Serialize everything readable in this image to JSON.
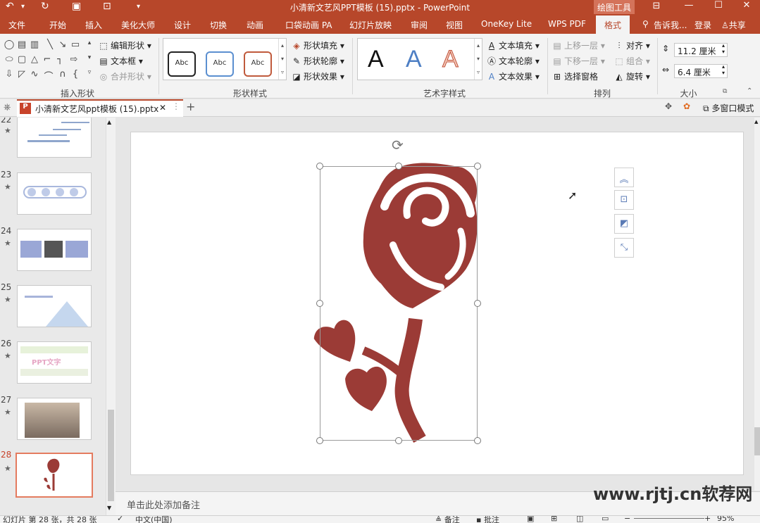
{
  "window": {
    "title": "小清新文艺风PPT模板 (15).pptx - PowerPoint",
    "context_tab": "绘图工具",
    "quick_access": [
      "undo-icon",
      "redo-icon",
      "save-icon",
      "present-icon",
      "customize-icon"
    ]
  },
  "ribbon_tabs": [
    "文件",
    "开始",
    "插入",
    "美化大师",
    "设计",
    "切换",
    "动画",
    "口袋动画 PA",
    "幻灯片放映",
    "审阅",
    "视图",
    "OneKey Lite",
    "WPS PDF",
    "格式"
  ],
  "active_tab": "格式",
  "tell_me": "告诉我...",
  "login": "登录",
  "share": "共享",
  "groups": {
    "insert_shapes": {
      "label": "插入形状",
      "edit_shape": "编辑形状",
      "textbox": "文本框",
      "merge_shapes": "合并形状"
    },
    "shape_styles": {
      "label": "形状样式",
      "samples": [
        "Abc",
        "Abc",
        "Abc"
      ],
      "fill": "形状填充",
      "outline": "形状轮廓",
      "effects": "形状效果"
    },
    "wordart": {
      "label": "艺术字样式",
      "samples": [
        "A",
        "A",
        "A"
      ],
      "text_fill": "文本填充",
      "text_outline": "文本轮廓",
      "text_effects": "文本效果"
    },
    "arrange": {
      "label": "排列",
      "bring_forward": "上移一层",
      "send_backward": "下移一层",
      "selection_pane": "选择窗格",
      "align": "对齐",
      "group": "组合",
      "rotate": "旋转"
    },
    "size": {
      "label": "大小",
      "height": "11.2 厘米",
      "width": "6.4 厘米"
    }
  },
  "document_tab": {
    "name": "小清新文艺风ppt模板 (15).pptx",
    "multi_window": "多窗口模式"
  },
  "slides": [
    {
      "num": "22",
      "star": "★"
    },
    {
      "num": "23",
      "star": "★"
    },
    {
      "num": "24",
      "star": "★"
    },
    {
      "num": "25",
      "star": "★"
    },
    {
      "num": "26",
      "star": "★"
    },
    {
      "num": "27",
      "star": "★"
    },
    {
      "num": "28",
      "star": "★"
    }
  ],
  "thumb26_text": "PPT文字",
  "notes_placeholder": "单击此处添加备注",
  "status": {
    "slide_info": "幻灯片 第 28 张，共 28 张",
    "language": "中文(中国)",
    "notes": "备注",
    "comments": "批注",
    "zoom": "95%"
  },
  "watermark": "www.rjtj.cn软荐网",
  "colors": {
    "accent": "#b7472a",
    "rose": "#9b3b36"
  }
}
